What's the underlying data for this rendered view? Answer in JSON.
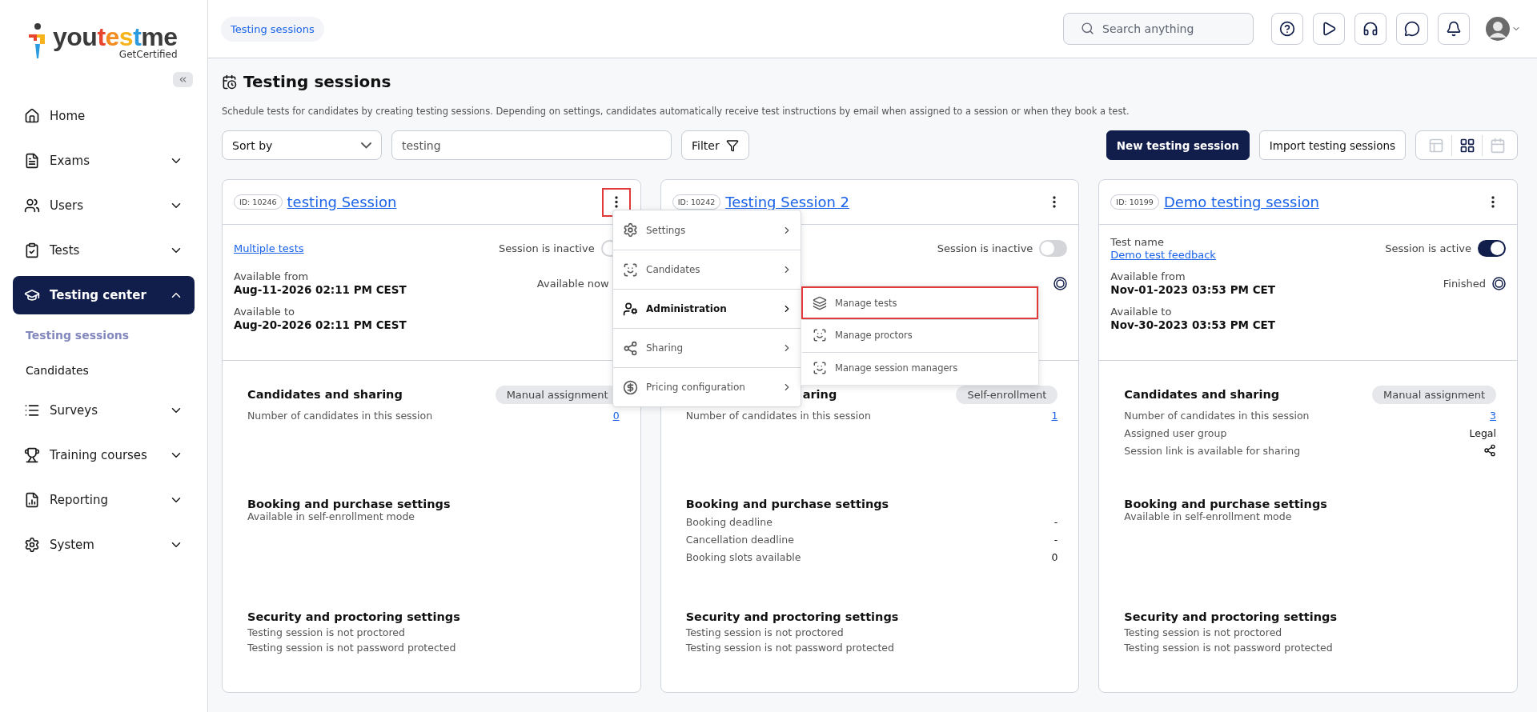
{
  "sidebar": {
    "logo": {
      "segments": [
        {
          "text": "you",
          "color": "#3a3a3a"
        },
        {
          "text": "t",
          "color": "#e8452c"
        },
        {
          "text": "e",
          "color": "#f28c1f"
        },
        {
          "text": "s",
          "color": "#f5b41c"
        },
        {
          "text": "t",
          "color": "#2b9be0"
        },
        {
          "text": "me",
          "color": "#3a3a3a"
        }
      ],
      "tagline": "GetCertified"
    },
    "items": [
      {
        "label": "Home",
        "kind": "link",
        "selected": false
      },
      {
        "label": "Exams",
        "kind": "group",
        "expanded": false,
        "selected": false
      },
      {
        "label": "Users",
        "kind": "group",
        "expanded": false,
        "selected": false
      },
      {
        "label": "Tests",
        "kind": "group",
        "expanded": false,
        "selected": false
      },
      {
        "label": "Testing center",
        "kind": "group",
        "expanded": true,
        "selected": true,
        "children": [
          {
            "label": "Testing sessions",
            "selected": true
          },
          {
            "label": "Candidates",
            "selected": false
          }
        ]
      },
      {
        "label": "Surveys",
        "kind": "group",
        "expanded": false,
        "selected": false
      },
      {
        "label": "Training courses",
        "kind": "group",
        "expanded": false,
        "selected": false
      },
      {
        "label": "Reporting",
        "kind": "group",
        "expanded": false,
        "selected": false
      },
      {
        "label": "System",
        "kind": "group",
        "expanded": false,
        "selected": false
      }
    ]
  },
  "header": {
    "breadcrumb": "Testing sessions",
    "search": {
      "placeholder": "Search anything"
    }
  },
  "page": {
    "title": "Testing sessions",
    "description": "Schedule tests for candidates by creating testing sessions. Depending on settings, candidates automatically receive test instructions by email when assigned to a session or when they book a test.",
    "toolbar": {
      "sort": "Sort by",
      "search": {
        "value": "testing"
      },
      "filter": "Filter",
      "buttons": [
        {
          "label": "New testing session",
          "kind": "primary"
        },
        {
          "label": "Import testing sessions",
          "kind": "secondary"
        }
      ],
      "views": [
        {
          "selected": false
        },
        {
          "selected": true
        },
        {
          "selected": false
        }
      ]
    }
  },
  "cards": [
    {
      "id": "ID: 10246",
      "title": "testing Session",
      "menu_highlighted": true,
      "top": {
        "test_link": "Multiple tests",
        "toggle_label": "Session is inactive",
        "active": false,
        "from_label": "Available from",
        "from_value": "Aug-11-2026 02:11 PM CEST",
        "status": "Available now",
        "indicator": false,
        "to_label": "Available to",
        "to_value": "Aug-20-2026 02:11 PM CEST"
      },
      "candidates": {
        "heading": "Candidates and sharing",
        "cut": false,
        "mode": "Manual assignment",
        "rows": [
          {
            "label": "Number of candidates in this session",
            "value": "0",
            "kind": "link"
          }
        ]
      },
      "booking": {
        "heading": "Booking and purchase settings",
        "note": "Available in self-enrollment mode"
      },
      "security": {
        "heading": "Security and proctoring settings",
        "lines": [
          "Testing session is not proctored",
          "Testing session is not password protected"
        ]
      },
      "menu": {
        "items": [
          {
            "label": "Settings",
            "selected": false
          },
          {
            "label": "Candidates",
            "selected": false
          },
          {
            "label": "Administration",
            "selected": true
          },
          {
            "label": "Sharing",
            "selected": false
          },
          {
            "label": "Pricing configuration",
            "selected": false
          }
        ],
        "submenu": [
          {
            "label": "Manage tests",
            "highlighted": true
          },
          {
            "label": "Manage proctors",
            "highlighted": false
          },
          {
            "label": "Manage session managers",
            "highlighted": false
          }
        ]
      }
    },
    {
      "id": "ID: 10242",
      "title": "Testing Session 2",
      "menu_highlighted": false,
      "top": {
        "toggle_label": "Session is inactive",
        "active": false,
        "indicator": true
      },
      "candidates": {
        "heading": "aring",
        "cut": true,
        "mode": "Self-enrollment",
        "rows": [
          {
            "label": "Number of candidates in this session",
            "value": "1",
            "kind": "link"
          }
        ]
      },
      "booking": {
        "heading": "Booking and purchase settings",
        "rows": [
          {
            "label": "Booking deadline",
            "value": "-"
          },
          {
            "label": "Cancellation deadline",
            "value": "-"
          },
          {
            "label": "Booking slots available",
            "value": "0"
          }
        ]
      },
      "security": {
        "heading": "Security and proctoring settings",
        "lines": [
          "Testing session is not proctored",
          "Testing session is not password protected"
        ]
      }
    },
    {
      "id": "ID: 10199",
      "title": "Demo testing session",
      "menu_highlighted": false,
      "top": {
        "test_label": "Test name",
        "test_link": "Demo test feedback",
        "toggle_label": "Session is active",
        "active": true,
        "from_label": "Available from",
        "from_value": "Nov-01-2023 03:53 PM CET",
        "status": "Finished",
        "indicator": true,
        "to_label": "Available to",
        "to_value": "Nov-30-2023 03:53 PM CET"
      },
      "candidates": {
        "heading": "Candidates and sharing",
        "cut": false,
        "mode": "Manual assignment",
        "rows": [
          {
            "label": "Number of candidates in this session",
            "value": "3",
            "kind": "link"
          },
          {
            "label": "Assigned user group",
            "value": "Legal",
            "kind": "text"
          },
          {
            "label": "Session link is available for sharing",
            "kind": "share"
          }
        ]
      },
      "booking": {
        "heading": "Booking and purchase settings",
        "note": "Available in self-enrollment mode"
      },
      "security": {
        "heading": "Security and proctoring settings",
        "lines": [
          "Testing session is not proctored",
          "Testing session is not password protected"
        ]
      }
    }
  ]
}
